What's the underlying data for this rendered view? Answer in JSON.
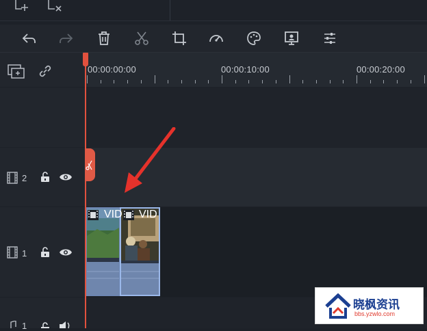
{
  "ruler": {
    "tc0": "00:00:00:00",
    "tc10": "00:00:10:00",
    "tc20": "00:00:20:00"
  },
  "tracks": [
    {
      "number": "2"
    },
    {
      "number": "1"
    },
    {
      "number": "1"
    }
  ],
  "clips": [
    {
      "label": "VID"
    },
    {
      "label": "VID"
    }
  ],
  "watermark": {
    "title": "晓枫资讯",
    "url": "bbs.yzwlo.com"
  },
  "colors": {
    "playhead": "#e2513e",
    "clip": "#6f86ad",
    "selected_border": "#9bb8ea"
  },
  "icons": {
    "top": [
      "add-media-icon",
      "remove-media-icon"
    ],
    "toolbar": [
      "undo-icon",
      "redo-icon",
      "delete-icon",
      "cut-icon",
      "crop-icon",
      "speed-icon",
      "color-palette-icon",
      "green-screen-icon",
      "adjust-sliders-icon"
    ]
  }
}
